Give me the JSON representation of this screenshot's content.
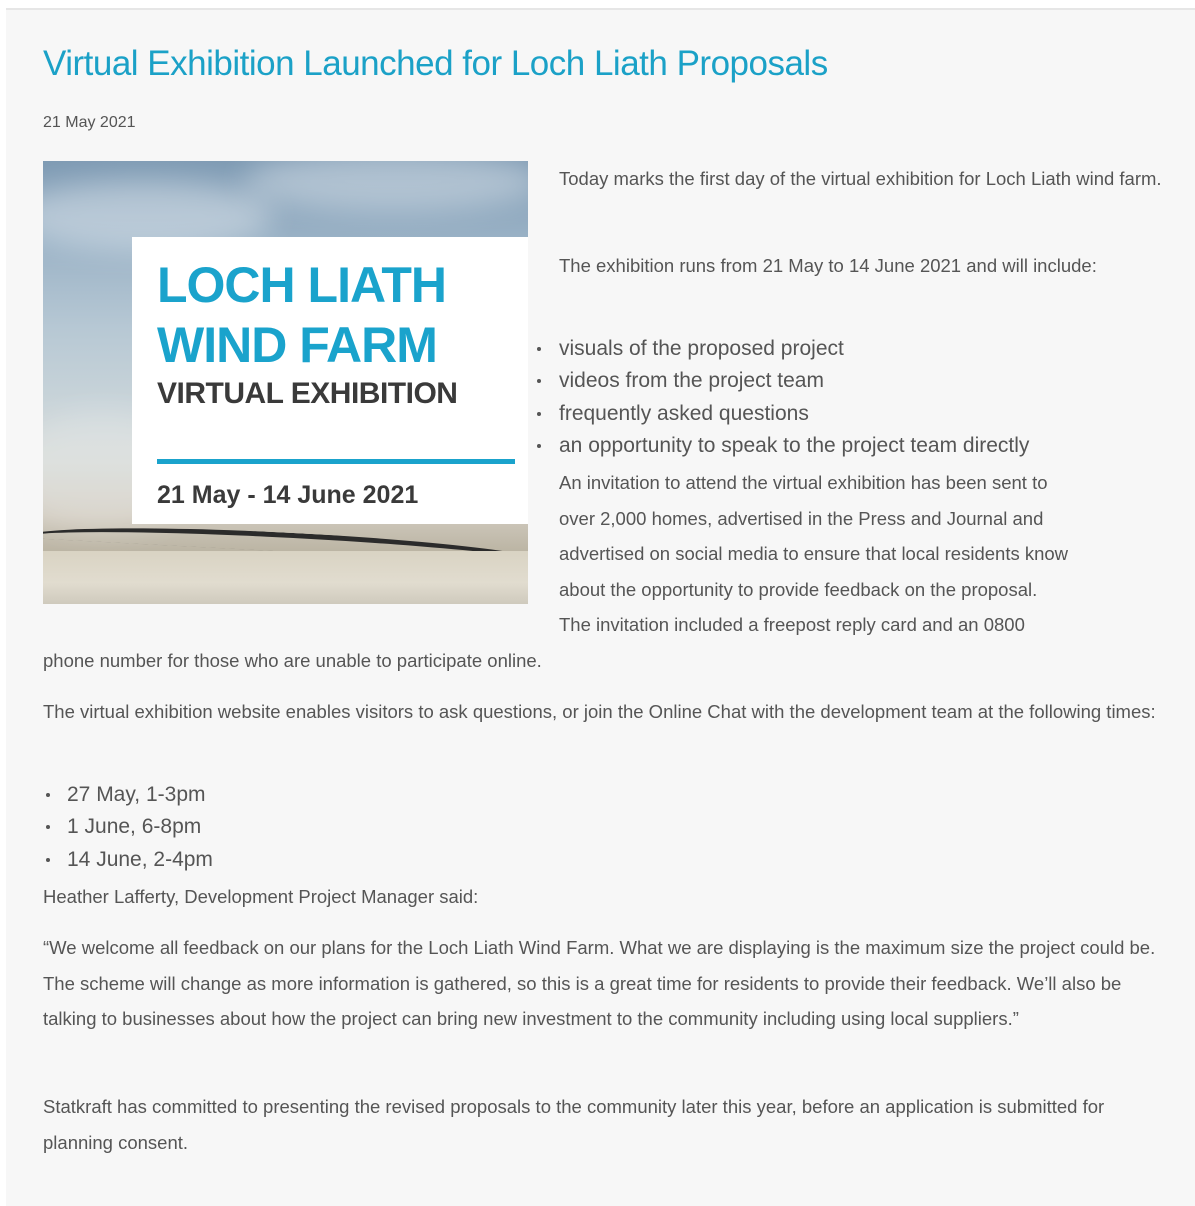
{
  "article": {
    "title": "Virtual Exhibition Launched for Loch Liath Proposals",
    "date": "21 May 2021"
  },
  "hero_image": {
    "line1": "LOCH LIATH",
    "line2": "WIND FARM",
    "subtitle": "VIRTUAL EXHIBITION",
    "dates": "21 May - 14 June 2021",
    "accent_color": "#1aa3cc"
  },
  "body": {
    "intro": "Today marks the first day of the virtual exhibition for Loch Liath wind farm.",
    "runs": "The exhibition runs from 21 May to 14 June 2021 and will include:",
    "includes": [
      "visuals of the proposed project",
      "videos from the project team",
      "frequently asked questions",
      "an opportunity to speak to the project team directly"
    ],
    "invitation": [
      "An invitation to attend the virtual exhibition has been sent to",
      "over 2,000 homes, advertised in the Press and Journal and",
      "advertised on social media to ensure that local residents know",
      "about the opportunity to provide feedback on the proposal.",
      "The invitation included a freepost reply card and an 0800",
      "phone number for those who are unable to participate online."
    ],
    "chat_intro": "The virtual exhibition website enables visitors to ask questions, or join the Online Chat with the development team at the following times:",
    "chat_times": [
      "27 May, 1-3pm",
      "1 June, 6-8pm",
      "14 June, 2-4pm"
    ],
    "attribution": "Heather Lafferty, Development Project Manager said:",
    "quote": "“We welcome all feedback on our plans for the Loch Liath Wind Farm. What we are displaying is the maximum size the project could be. The scheme will change as more information is gathered, so this is a great time for residents to provide their feedback. We’ll also be talking to businesses about how the project can bring new investment to the community including using local suppliers.”",
    "closing": "Statkraft has committed to presenting the revised proposals to the community later this year, before an application is submitted for planning consent."
  }
}
